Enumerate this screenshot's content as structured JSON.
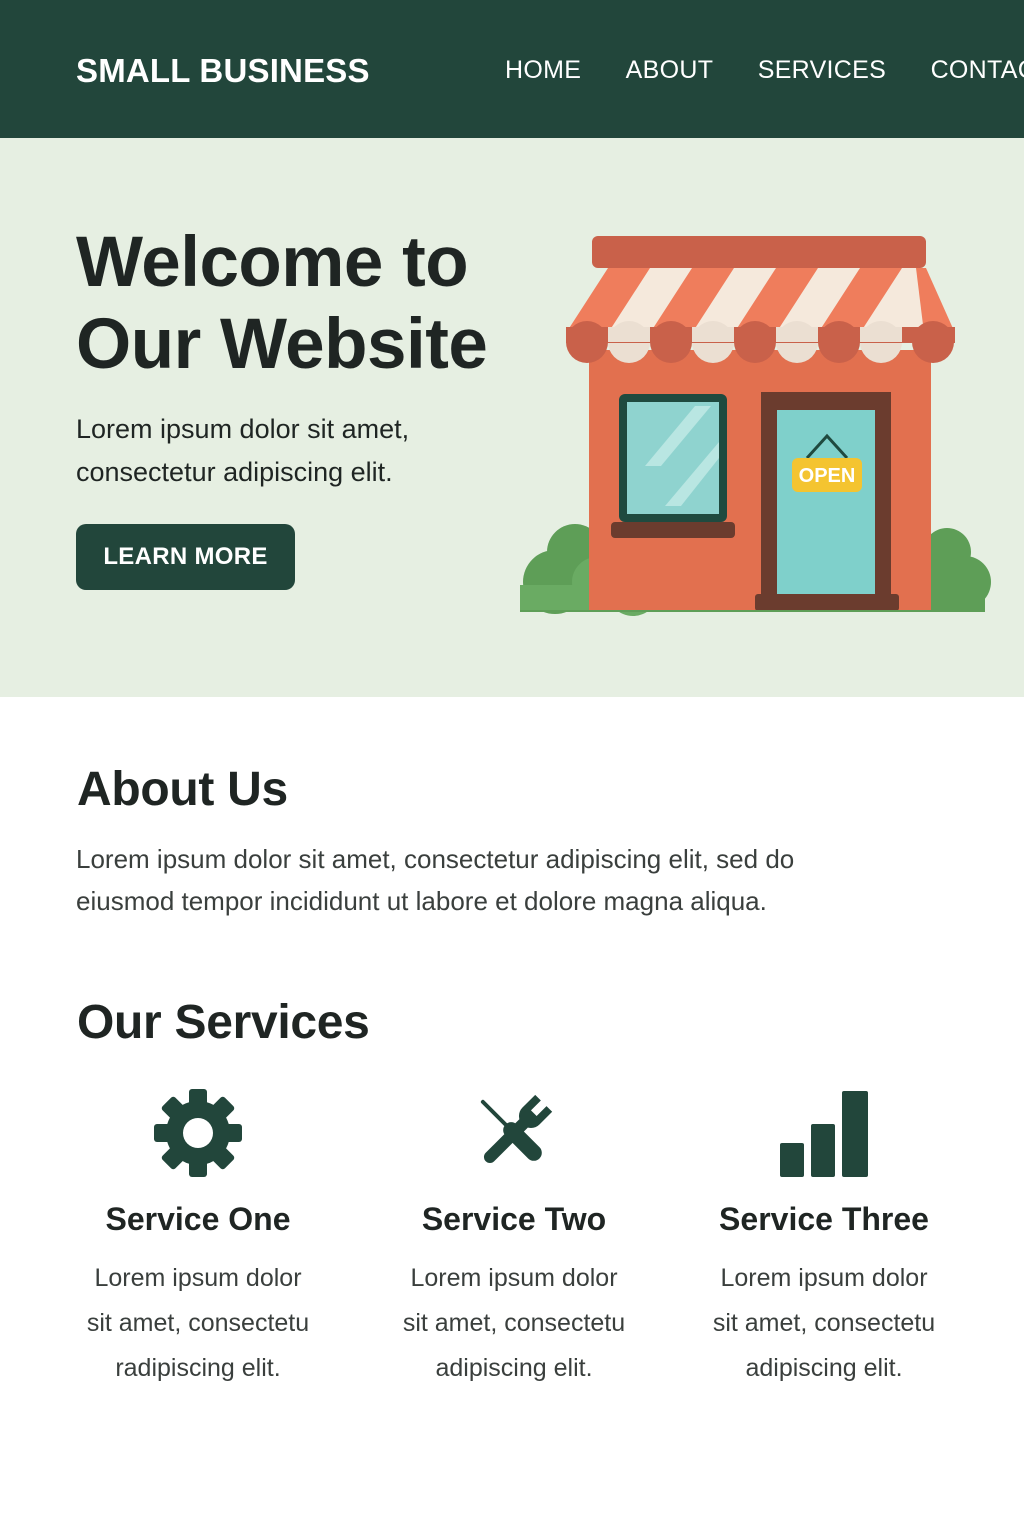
{
  "header": {
    "brand": "SMALL BUSINESS",
    "nav": [
      "HOME",
      "ABOUT",
      "SERVICES",
      "CONTACT"
    ]
  },
  "hero": {
    "title_lines": [
      "Welcome to",
      "Our Website"
    ],
    "subtitle_lines": [
      "Lorem ipsum dolor sit amet,",
      "consectetur adipiscing elit."
    ],
    "cta_label": "LEARN MORE",
    "illustration": {
      "name": "storefront-illustration",
      "sign_text": "OPEN"
    }
  },
  "about": {
    "title": "About Us",
    "text_lines": [
      "Lorem ipsum dolor  sit amet, consectetur adipiscing elit, sed do",
      "eiusmod tempor incididunt ut labore et dolore magna aliqua."
    ]
  },
  "services": {
    "title": "Our Services",
    "items": [
      {
        "icon": "gear-icon",
        "title": "Service One",
        "desc_lines": [
          "Lorem ipsum dolor",
          "sit amet, consectetu",
          "radipiscing elit."
        ]
      },
      {
        "icon": "tools-icon",
        "title": "Service Two",
        "desc_lines": [
          "Lorem ipsum dolor",
          "sit amet, consectetu",
          "adipiscing elit."
        ]
      },
      {
        "icon": "bar-chart-icon",
        "title": "Service Three",
        "desc_lines": [
          "Lorem ipsum dolor",
          "sit amet, consectetu",
          "adipiscing elit."
        ]
      }
    ]
  },
  "colors": {
    "header_bg": "#22463b",
    "hero_bg": "#e6efe2",
    "accent": "#22463b",
    "awning": "#ef7d5c",
    "storefront": "#e2704f",
    "glass": "#8fd3cf",
    "sign": "#f4c430"
  }
}
